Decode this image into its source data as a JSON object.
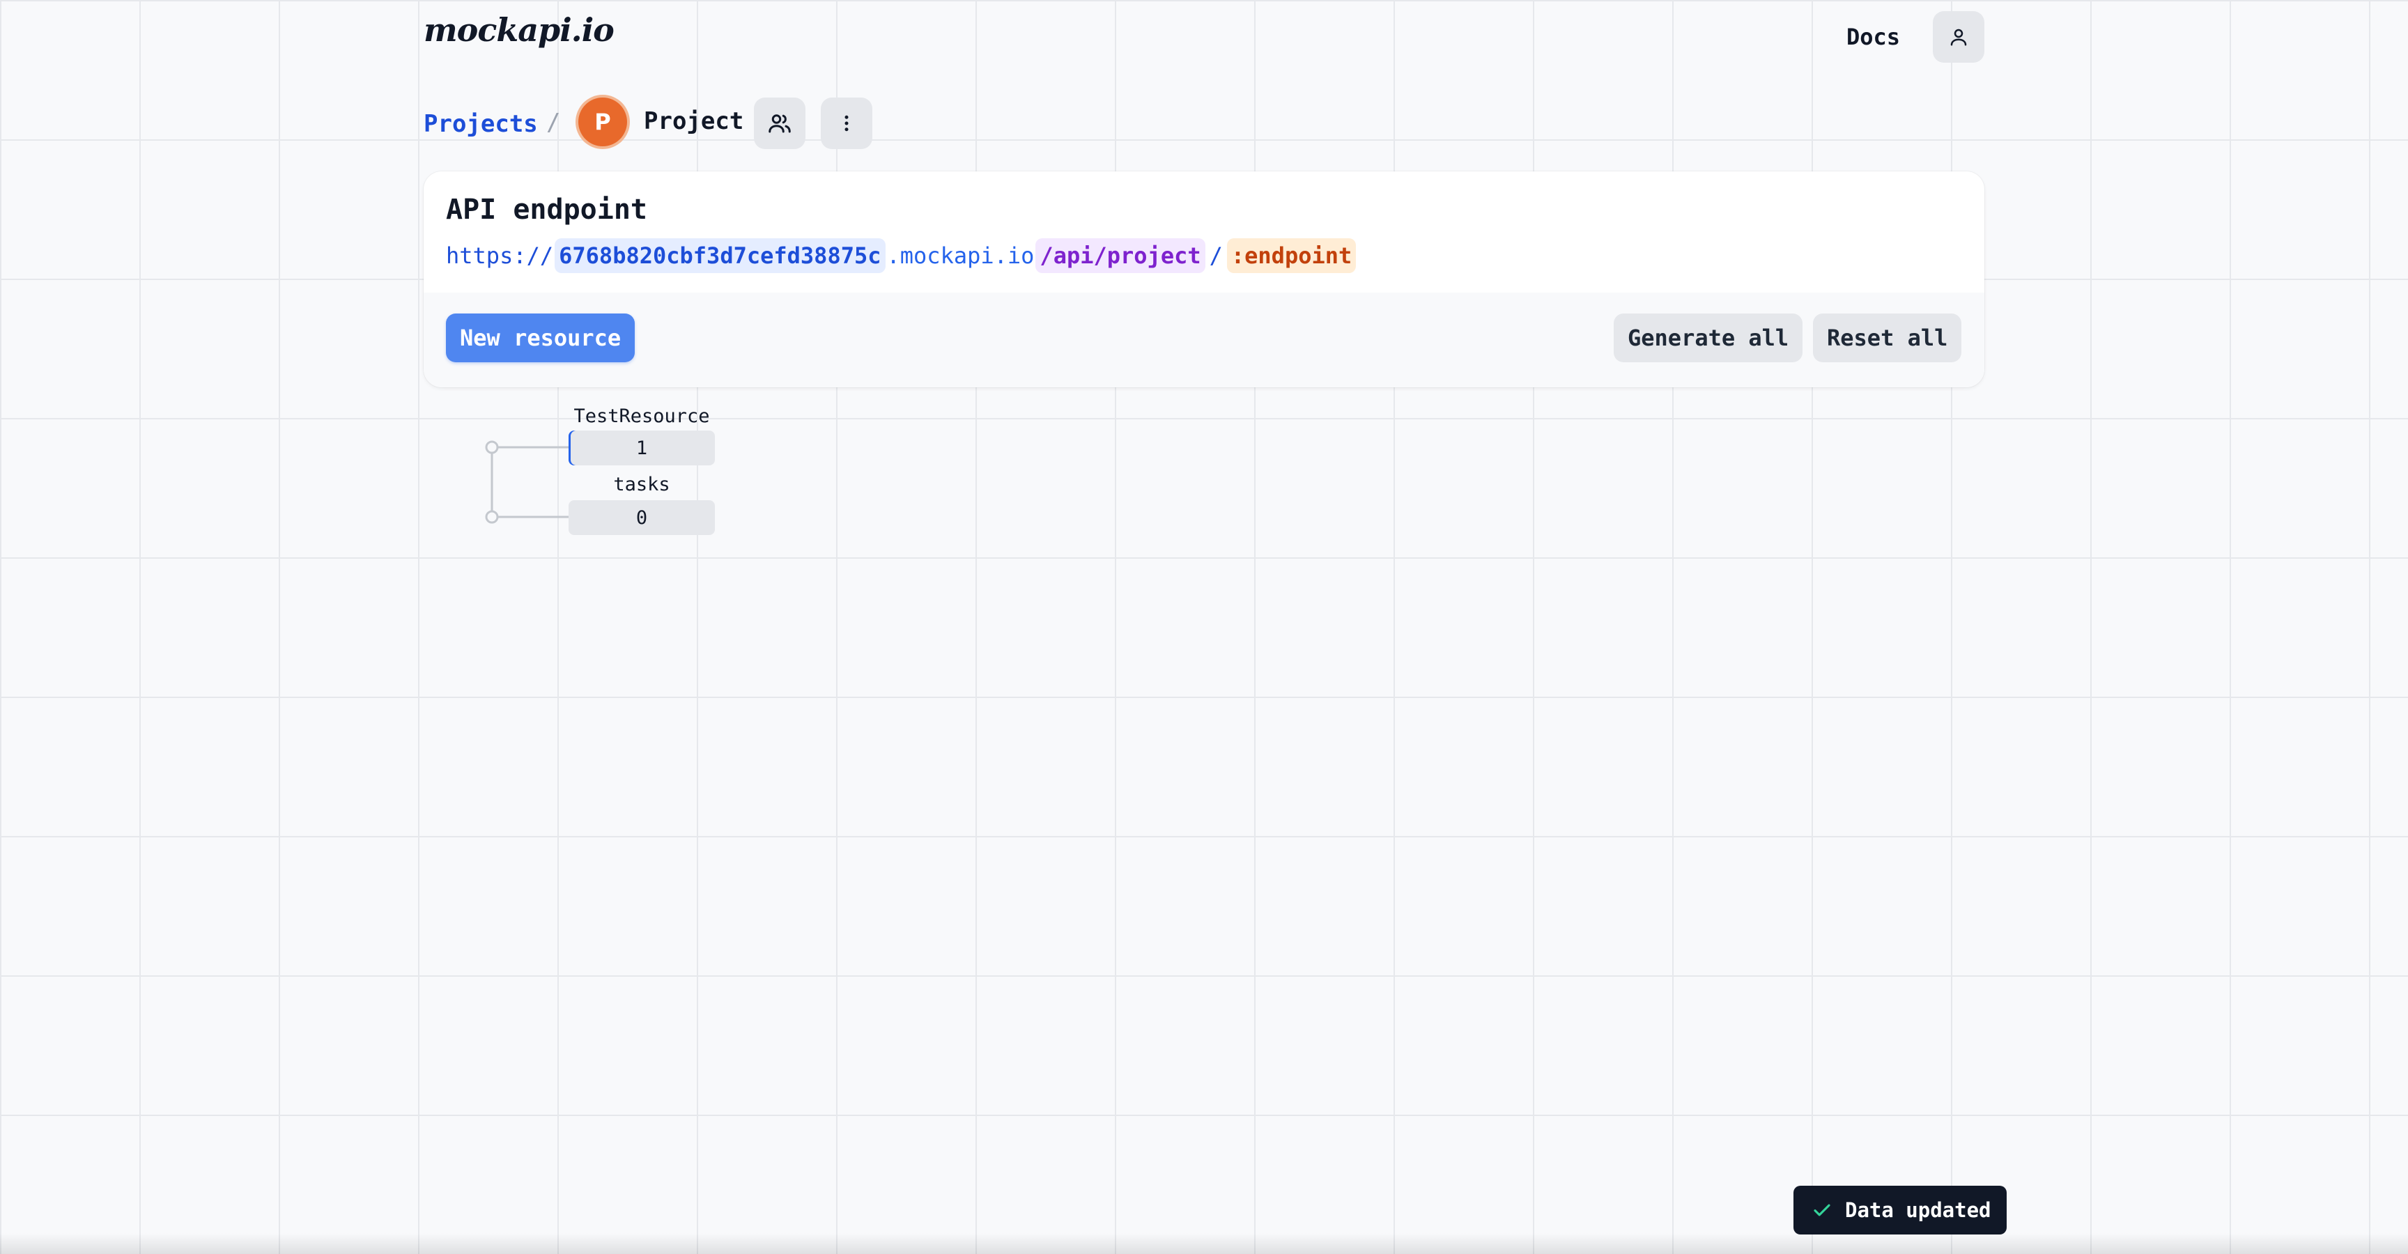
{
  "header": {
    "logo_text": "mockapi.io",
    "docs_label": "Docs",
    "user_icon": "user-icon"
  },
  "breadcrumb": {
    "projects_label": "Projects",
    "separator": "/",
    "avatar_letter": "P",
    "project_name": "Project",
    "members_icon": "users-icon",
    "menu_icon": "more-vertical-icon"
  },
  "endpoint_card": {
    "title": "API endpoint",
    "url": {
      "protocol": "https://",
      "id": "6768b820cbf3d7cefd38875c",
      "host": ".mockapi.io",
      "path": "/api/project",
      "slash": "/",
      "endpoint": ":endpoint"
    },
    "new_resource_label": "New resource",
    "generate_all_label": "Generate all",
    "reset_all_label": "Reset all"
  },
  "resources": [
    {
      "name": "TestResource",
      "count": "1"
    },
    {
      "name": "tasks",
      "count": "0"
    }
  ],
  "toast": {
    "message": "Data updated",
    "icon": "check-icon"
  },
  "colors": {
    "background": "#f8f9fb",
    "grid_line": "#e6e8ec",
    "primary": "#4f86f0",
    "link": "#1d4ed8",
    "avatar": "#e8692b",
    "path": "#7e22ce",
    "endpoint": "#c2410c",
    "toast_bg": "#111827"
  }
}
